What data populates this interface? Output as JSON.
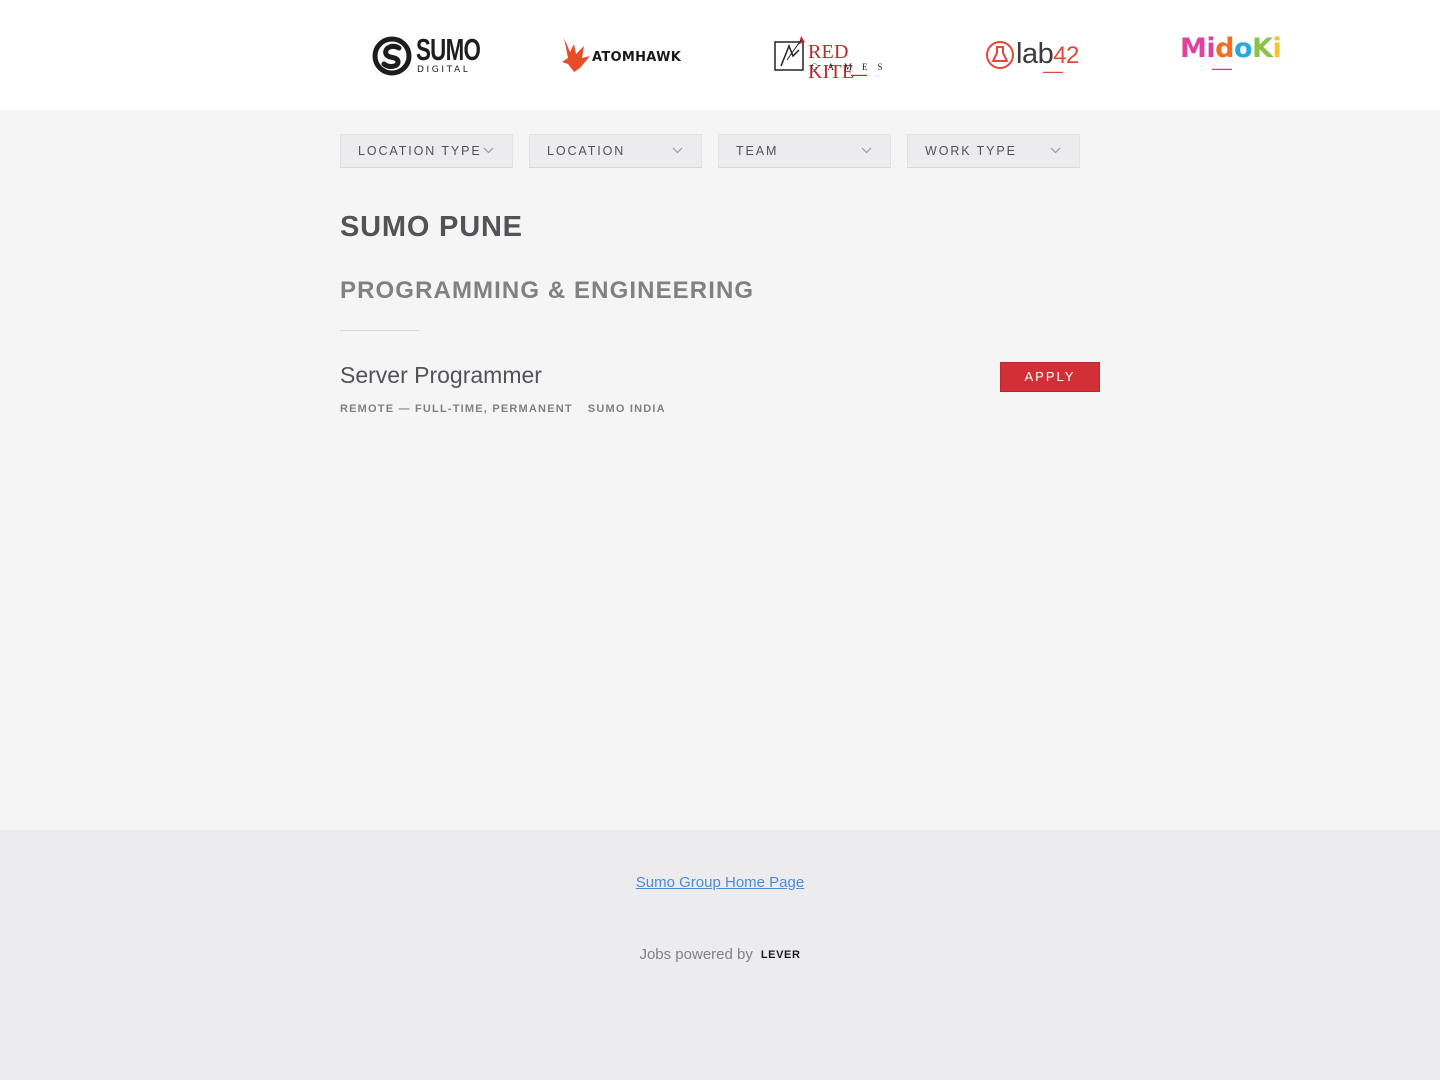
{
  "logos": {
    "sumo": {
      "word": "SUMO",
      "sub": "DIGITAL"
    },
    "atomhawk": {
      "word": "ATOMHAWK"
    },
    "redkite": {
      "word": "RED KITE",
      "sub": "GAMES"
    },
    "lab42": {
      "word": "lab",
      "num": "42"
    },
    "midoki": {
      "letters": [
        "M",
        "i",
        "d",
        "o",
        "K",
        "i"
      ]
    }
  },
  "colors": {
    "apply_button": "#d32f37",
    "link": "#4b8bd6",
    "sumo_red": "#c0272d",
    "lab42_accent": "#e2483a",
    "midoki_letters": [
      "#e040a0",
      "#e040a0",
      "#f36c21",
      "#2aa8e0",
      "#8bc34a",
      "#fbc02d"
    ]
  },
  "filters": [
    {
      "label": "Location type",
      "icon": "chevron-down-icon"
    },
    {
      "label": "Location",
      "icon": "chevron-down-icon"
    },
    {
      "label": "Team",
      "icon": "chevron-down-icon"
    },
    {
      "label": "Work type",
      "icon": "chevron-down-icon"
    }
  ],
  "group": {
    "title": "SUMO PUNE",
    "subtitle": "PROGRAMMING & ENGINEERING"
  },
  "postings": [
    {
      "title": "Server Programmer",
      "location": "REMOTE — FULL-TIME, PERMANENT",
      "team": "SUMO INDIA",
      "apply_label": "APPLY"
    }
  ],
  "footer": {
    "home_link": "Sumo Group Home Page",
    "powered_prefix": "Jobs powered by",
    "powered_brand": "LEVER"
  }
}
